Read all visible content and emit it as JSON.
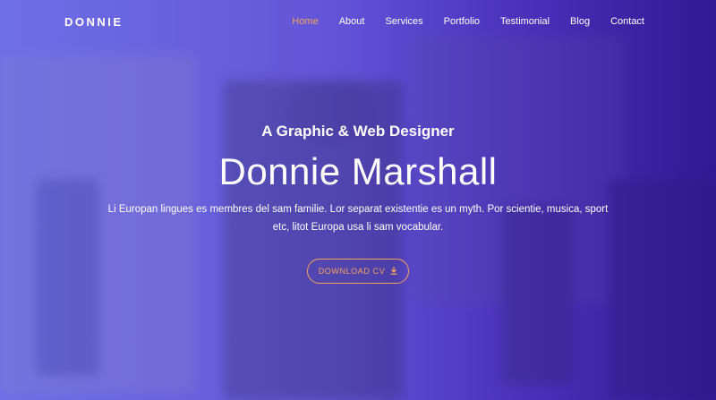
{
  "brand": {
    "logo": "DONNIE"
  },
  "nav": {
    "items": [
      {
        "label": "Home",
        "active": true
      },
      {
        "label": "About"
      },
      {
        "label": "Services"
      },
      {
        "label": "Portfolio"
      },
      {
        "label": "Testimonial"
      },
      {
        "label": "Blog"
      },
      {
        "label": "Contact"
      }
    ]
  },
  "hero": {
    "subtitle": "A Graphic & Web Designer",
    "title": "Donnie Marshall",
    "description": "Li Europan lingues es membres del sam familie. Lor separat existentie es un myth. Por scientie, musica, sport etc, litot Europa usa li sam vocabular.",
    "cta_label": "DOWNLOAD CV",
    "cta_icon": "download-icon"
  },
  "colors": {
    "accent": "#f5a35a",
    "overlay_start": "#6f6fe0",
    "overlay_end": "#2c1a8e"
  }
}
